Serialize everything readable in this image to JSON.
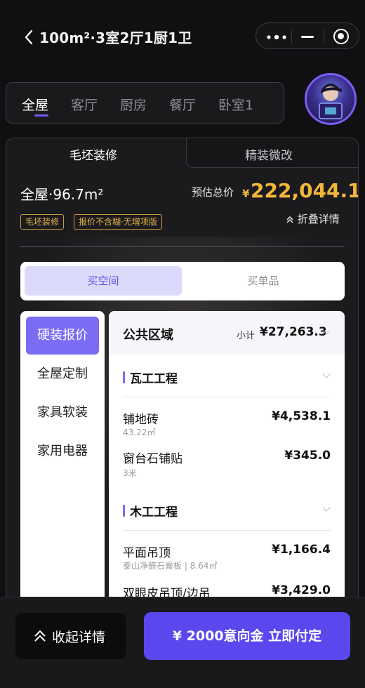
{
  "header": {
    "title": "100m²·3室2厅1厨1卫"
  },
  "room_tabs": [
    {
      "label": "全屋",
      "active": true
    },
    {
      "label": "客厅",
      "active": false
    },
    {
      "label": "厨房",
      "active": false
    },
    {
      "label": "餐厅",
      "active": false
    },
    {
      "label": "卧室1",
      "active": false
    }
  ],
  "panel": {
    "tabs": [
      {
        "label": "毛坯装修",
        "active": true
      },
      {
        "label": "精装微改",
        "active": false
      }
    ],
    "area_label": "全屋·96.7m²",
    "estimate_label": "预估总价",
    "currency_symbol": "¥",
    "total_price": "222,044.1",
    "tags": [
      "毛坯装修",
      "报价不含糊·无增项版"
    ],
    "fold_label": "折叠详情",
    "segments": [
      {
        "label": "买空间",
        "active": true
      },
      {
        "label": "买单品",
        "active": false
      }
    ],
    "categories": [
      {
        "label": "硬装报价",
        "active": true
      },
      {
        "label": "全屋定制",
        "active": false
      },
      {
        "label": "家具软装",
        "active": false
      },
      {
        "label": "家用电器",
        "active": false
      }
    ],
    "detail": {
      "header_title": "公共区域",
      "subtotal_label": "小计",
      "subtotal_value": "¥27,263.3",
      "sections": [
        {
          "title": "瓦工工程",
          "items": [
            {
              "name": "铺地砖",
              "sub": "43.22㎡",
              "price": "¥4,538.1"
            },
            {
              "name": "窗台石铺贴",
              "sub": "3米",
              "price": "¥345.0"
            }
          ]
        },
        {
          "title": "木工工程",
          "items": [
            {
              "name": "平面吊顶",
              "sub": "泰山净醛石膏板 | 8.64㎡",
              "price": "¥1,166.4"
            },
            {
              "name": "双眼皮吊顶/边吊",
              "sub": "",
              "price": "¥3,429.0"
            }
          ]
        }
      ]
    }
  },
  "bottom": {
    "collapse_label": "收起详情",
    "deposit_label": "¥ 2000意向金 立即付定"
  },
  "colors": {
    "accent": "#5a47ee",
    "price": "#f3b63b",
    "tag_border": "#c89b3a"
  }
}
